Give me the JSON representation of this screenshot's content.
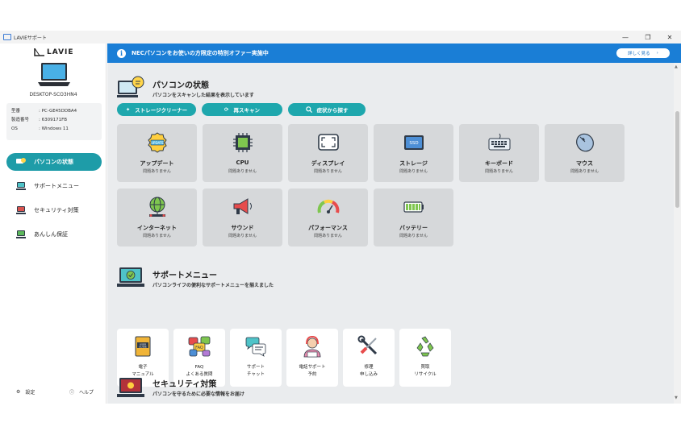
{
  "window": {
    "title": "LAVIEサポート",
    "minimize": "—",
    "maximize": "❐",
    "close": "✕"
  },
  "sidebar": {
    "brand": "LAVIE",
    "device_name": "DESKTOP-SCO3HN4",
    "specs": [
      {
        "key": "型番",
        "value": ": PC-GE45DDBA4"
      },
      {
        "key": "製造番号",
        "value": ": 6309171FB"
      },
      {
        "key": "OS",
        "value": ": Windows 11"
      }
    ],
    "nav": [
      {
        "label": "パソコンの状態",
        "active": true
      },
      {
        "label": "サポートメニュー",
        "active": false
      },
      {
        "label": "セキュリティ対策",
        "active": false
      },
      {
        "label": "あんしん保証",
        "active": false
      }
    ],
    "settings": "設定",
    "help": "ヘルプ"
  },
  "banner": {
    "text": "NECパソコンをお使いの方限定の特別オファー実施中",
    "button": "詳しく見る",
    "arrow": "›",
    "info": "i"
  },
  "pc_status": {
    "title": "パソコンの状態",
    "subtitle": "パソコンをスキャンした結果を表示しています",
    "buttons": [
      {
        "label": "ストレージクリーナー",
        "icon": "sparkle-icon"
      },
      {
        "label": "再スキャン",
        "icon": "refresh-icon"
      },
      {
        "label": "症状から探す",
        "icon": "search-icon"
      }
    ],
    "tiles": [
      {
        "name": "アップデート",
        "status": "問題ありません",
        "icon": "update-badge-icon"
      },
      {
        "name": "CPU",
        "status": "問題ありません",
        "icon": "cpu-chip-icon"
      },
      {
        "name": "ディスプレイ",
        "status": "問題ありません",
        "icon": "display-icon"
      },
      {
        "name": "ストレージ",
        "status": "問題ありません",
        "icon": "ssd-icon"
      },
      {
        "name": "キーボード",
        "status": "問題ありません",
        "icon": "keyboard-icon"
      },
      {
        "name": "マウス",
        "status": "問題ありません",
        "icon": "mouse-icon"
      },
      {
        "name": "インターネット",
        "status": "問題ありません",
        "icon": "globe-network-icon"
      },
      {
        "name": "サウンド",
        "status": "問題ありません",
        "icon": "megaphone-icon"
      },
      {
        "name": "パフォーマンス",
        "status": "問題ありません",
        "icon": "gauge-icon"
      },
      {
        "name": "バッテリー",
        "status": "問題ありません",
        "icon": "battery-icon"
      }
    ]
  },
  "support_menu": {
    "title": "サポートメニュー",
    "subtitle": "パソコンライフの便利なサポートメニューを揃えました",
    "cards": [
      {
        "label": "電子\nマニュアル",
        "icon": "user-guide-book-icon"
      },
      {
        "label": "FAQ\nよくある質問",
        "icon": "faq-bubbles-icon"
      },
      {
        "label": "サポート\nチャット",
        "icon": "chat-bubbles-icon"
      },
      {
        "label": "電話サポート\n予約",
        "icon": "headset-operator-icon"
      },
      {
        "label": "修理\n申し込み",
        "icon": "wrench-screwdriver-icon"
      },
      {
        "label": "買取\nリサイクル",
        "icon": "recycle-icon"
      }
    ]
  },
  "security": {
    "title": "セキュリティ対策",
    "subtitle": "パソコンを守るために必要な情報をお届け"
  },
  "colors": {
    "accent": "#1ea7ad",
    "banner": "#1a7ed6",
    "active_nav": "#1e9ca8",
    "tile": "#d6d8da"
  }
}
